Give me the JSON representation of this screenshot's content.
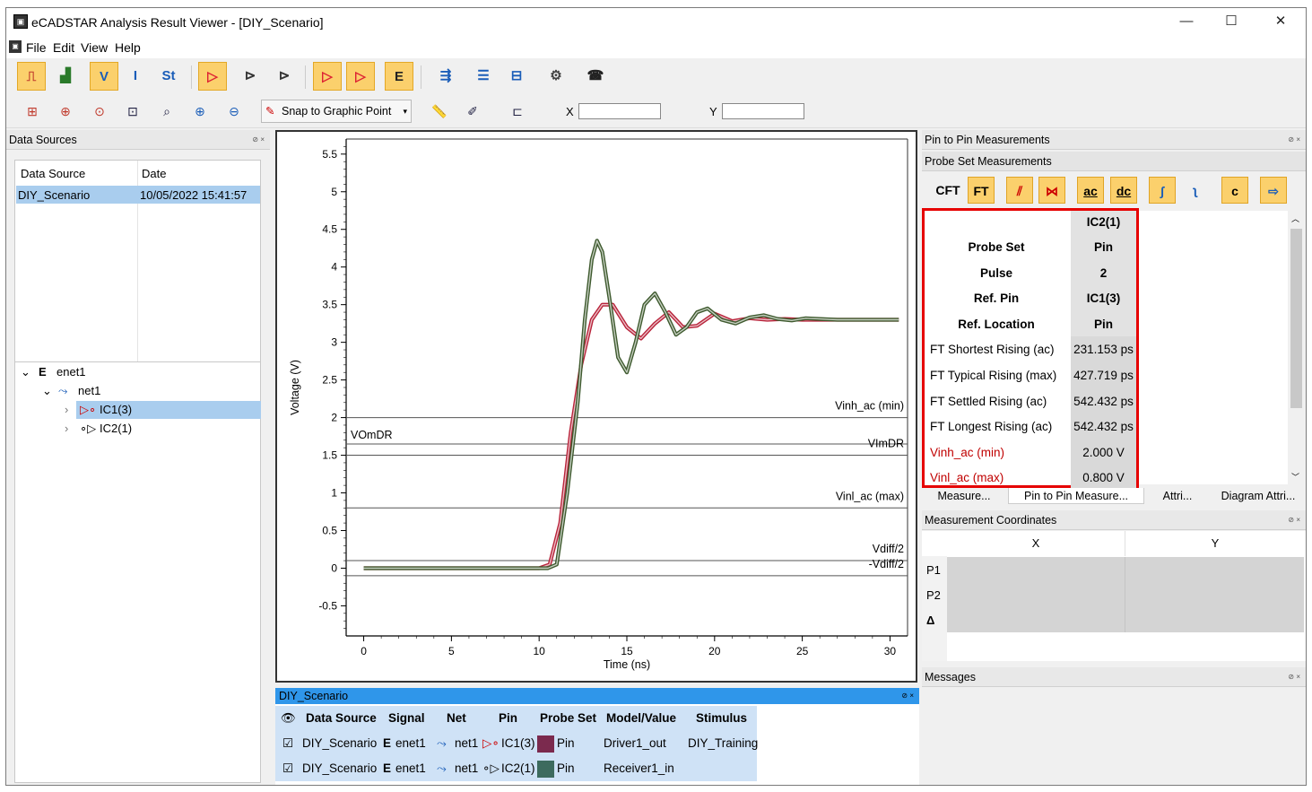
{
  "window": {
    "title": "eCADSTAR Analysis Result Viewer - [DIY_Scenario]",
    "app_icon": "app-logo-icon"
  },
  "menu": [
    "File",
    "Edit",
    "View",
    "Help"
  ],
  "toolbar2": {
    "snap_label": "Snap to Graphic Point",
    "x_label": "X",
    "x_value": "",
    "y_label": "Y",
    "y_value": ""
  },
  "data_sources": {
    "title": "Data Sources",
    "columns": [
      "Data Source",
      "Date"
    ],
    "rows": [
      {
        "source": "DIY_Scenario",
        "date": "10/05/2022 15:41:57"
      }
    ]
  },
  "tree": {
    "enet": "enet1",
    "net": "net1",
    "pin1": "IC1(3)",
    "pin2": "IC2(1)"
  },
  "chart_data": {
    "type": "line",
    "xlabel": "Time (ns)",
    "ylabel": "Voltage (V)",
    "xlim": [
      -1,
      31
    ],
    "ylim": [
      -0.9,
      5.7
    ],
    "xticks": [
      "0",
      "5",
      "10",
      "15",
      "20",
      "25",
      "30"
    ],
    "yticks": [
      "-0.5",
      "0",
      "0.5",
      "1",
      "1.5",
      "2",
      "2.5",
      "3",
      "3.5",
      "4",
      "4.5",
      "5",
      "5.5"
    ],
    "thresholds": [
      {
        "label": "Vinh_ac (min)",
        "y": 2.0,
        "side": "right"
      },
      {
        "label": "VOmDR",
        "y": 1.65,
        "side": "left"
      },
      {
        "label": "VImDR",
        "y": 1.5,
        "side": "right"
      },
      {
        "label": "Vinl_ac (max)",
        "y": 0.8,
        "side": "right"
      },
      {
        "label": "Vdiff/2",
        "y": 0.1,
        "side": "right"
      },
      {
        "label": "-Vdiff/2",
        "y": -0.1,
        "side": "right"
      }
    ],
    "series": [
      {
        "color": "#b8233a",
        "x": [
          0,
          8,
          10,
          10.6,
          11.2,
          11.8,
          12.4,
          13.0,
          13.6,
          14.2,
          15.0,
          15.8,
          16.6,
          17.4,
          18.2,
          19.0,
          20.0,
          21.0,
          22.0,
          23.0,
          24.0,
          25.0,
          26.0,
          27.0,
          28.0,
          29.0,
          30.0,
          30.5
        ],
        "y": [
          0,
          0,
          0,
          0.05,
          0.6,
          1.8,
          2.7,
          3.3,
          3.5,
          3.5,
          3.2,
          3.05,
          3.25,
          3.4,
          3.2,
          3.22,
          3.38,
          3.28,
          3.32,
          3.3,
          3.31,
          3.3,
          3.3,
          3.3,
          3.3,
          3.3,
          3.3,
          3.3
        ]
      },
      {
        "color": "#3e5a2e",
        "x": [
          0,
          8,
          10.5,
          11.0,
          11.6,
          12.2,
          12.6,
          13.0,
          13.3,
          13.6,
          14.0,
          14.5,
          15.0,
          15.5,
          16.0,
          16.6,
          17.2,
          17.8,
          18.4,
          19.0,
          19.6,
          20.4,
          21.2,
          22.0,
          22.8,
          23.6,
          24.4,
          25.2,
          26.0,
          27.0,
          28.0,
          29.0,
          30.0,
          30.5
        ],
        "y": [
          0,
          0,
          0,
          0.05,
          1.0,
          2.2,
          3.3,
          4.1,
          4.35,
          4.2,
          3.6,
          2.8,
          2.6,
          3.0,
          3.5,
          3.65,
          3.4,
          3.1,
          3.2,
          3.4,
          3.45,
          3.3,
          3.25,
          3.33,
          3.36,
          3.31,
          3.29,
          3.32,
          3.31,
          3.3,
          3.3,
          3.3,
          3.3,
          3.3
        ]
      }
    ]
  },
  "signals": {
    "title": "DIY_Scenario",
    "columns": [
      "Data Source",
      "Signal",
      "Net",
      "Pin",
      "Probe Set",
      "Model/Value",
      "Stimulus"
    ],
    "rows": [
      {
        "source": "DIY_Scenario",
        "signal": "enet1",
        "net": "net1",
        "pin": "IC1(3)",
        "probe": "Pin",
        "model": "Driver1_out",
        "stimulus": "DIY_Training",
        "swatch": "#7b2a4e"
      },
      {
        "source": "DIY_Scenario",
        "signal": "enet1",
        "net": "net1",
        "pin": "IC2(1)",
        "probe": "Pin",
        "model": "Receiver1_in",
        "stimulus": "",
        "swatch": "#3d6b5e"
      }
    ]
  },
  "pin_to_pin": {
    "title": "Pin to Pin Measurements",
    "subtitle": "Probe Set Measurements",
    "buttons": [
      "CFT",
      "FT",
      "ac",
      "dc",
      "c"
    ],
    "column": "IC2(1)",
    "rows": [
      {
        "label": "Probe Set",
        "value": "Pin"
      },
      {
        "label": "Pulse",
        "value": "2"
      },
      {
        "label": "Ref. Pin",
        "value": "IC1(3)"
      },
      {
        "label": "Ref. Location",
        "value": "Pin"
      },
      {
        "label": "FT Shortest Rising (ac)",
        "value": "231.153 ps"
      },
      {
        "label": "FT Typical Rising (max)",
        "value": "427.719 ps"
      },
      {
        "label": "FT Settled Rising (ac)",
        "value": "542.432 ps"
      },
      {
        "label": "FT Longest Rising (ac)",
        "value": "542.432 ps"
      },
      {
        "label": "Vinh_ac (min)",
        "value": "2.000 V"
      },
      {
        "label": "Vinl_ac (max)",
        "value": "0.800 V"
      }
    ],
    "tabs": [
      "Measure...",
      "Pin to Pin Measure...",
      "Attri...",
      "Diagram Attri..."
    ]
  },
  "measurement_coords": {
    "title": "Measurement Coordinates",
    "columns": [
      "X",
      "Y"
    ],
    "rows": [
      "P1",
      "P2",
      "Δ"
    ]
  },
  "messages": {
    "title": "Messages"
  }
}
